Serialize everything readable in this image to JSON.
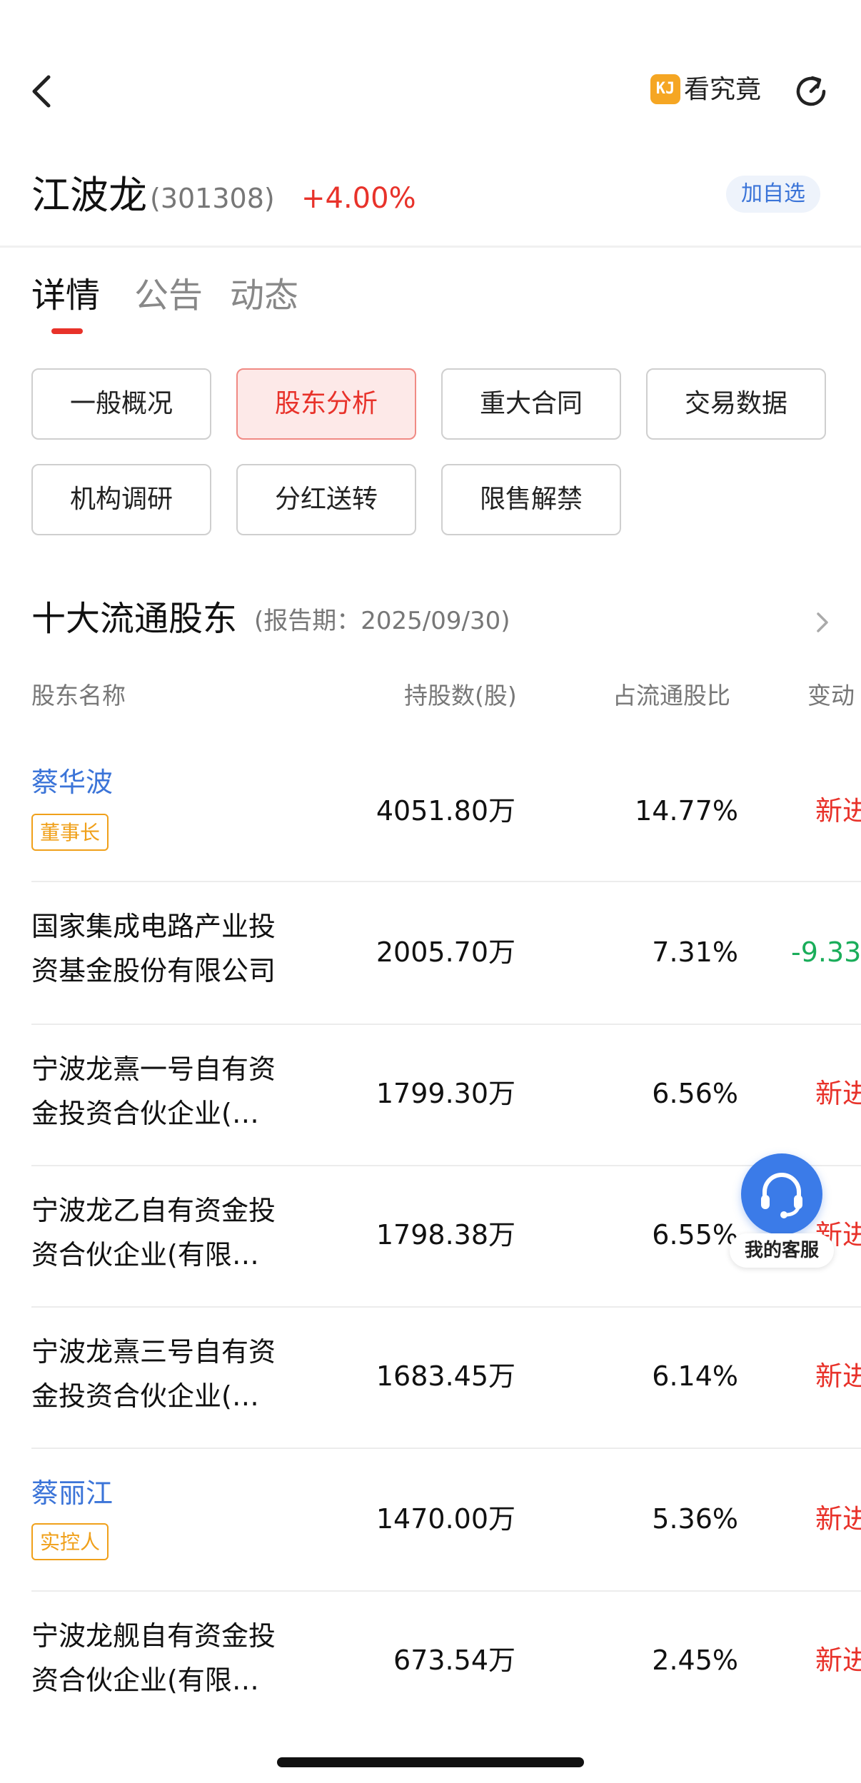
{
  "topbar": {
    "kanjiujing_badge": "KJ",
    "kanjiujing_label": "看究竟"
  },
  "stock": {
    "name": "江波龙",
    "code": "(301308)",
    "change": "+4.00%",
    "watch_label": "加自选"
  },
  "main_tabs": [
    "详情",
    "公告",
    "动态"
  ],
  "sub_tabs": [
    "一般概况",
    "股东分析",
    "重大合同",
    "交易数据",
    "机构调研",
    "分红送转",
    "限售解禁"
  ],
  "section": {
    "title": "十大流通股东",
    "report_period": "(报告期：2025/09/30)"
  },
  "table": {
    "headers": [
      "股东名称",
      "持股数(股)",
      "占流通股比",
      "变动"
    ],
    "rows": [
      {
        "name_l1": "蔡华波",
        "name_l2": "",
        "tag": "董事长",
        "shares": "4051.80万",
        "ratio": "14.77%",
        "change": "新进"
      },
      {
        "name_l1": "国家集成电路产业投",
        "name_l2": "资基金股份有限公司",
        "tag": "",
        "shares": "2005.70万",
        "ratio": "7.31%",
        "change": "-9.33"
      },
      {
        "name_l1": "宁波龙熹一号自有资",
        "name_l2": "金投资合伙企业(…",
        "tag": "",
        "shares": "1799.30万",
        "ratio": "6.56%",
        "change": "新进"
      },
      {
        "name_l1": "宁波龙乙自有资金投",
        "name_l2": "资合伙企业(有限…",
        "tag": "",
        "shares": "1798.38万",
        "ratio": "6.55%",
        "change": "新进"
      },
      {
        "name_l1": "宁波龙熹三号自有资",
        "name_l2": "金投资合伙企业(…",
        "tag": "",
        "shares": "1683.45万",
        "ratio": "6.14%",
        "change": "新进"
      },
      {
        "name_l1": "蔡丽江",
        "name_l2": "",
        "tag": "实控人",
        "shares": "1470.00万",
        "ratio": "5.36%",
        "change": "新进"
      },
      {
        "name_l1": "宁波龙舰自有资金投",
        "name_l2": "资合伙企业(有限…",
        "tag": "",
        "shares": "673.54万",
        "ratio": "2.45%",
        "change": "新进"
      }
    ]
  },
  "customer_service": {
    "label": "我的客服"
  },
  "colors": {
    "up_red": "#e8322a",
    "down_green": "#1aad5a",
    "link_blue": "#3b74d8",
    "tag_orange": "#f0a01a"
  }
}
